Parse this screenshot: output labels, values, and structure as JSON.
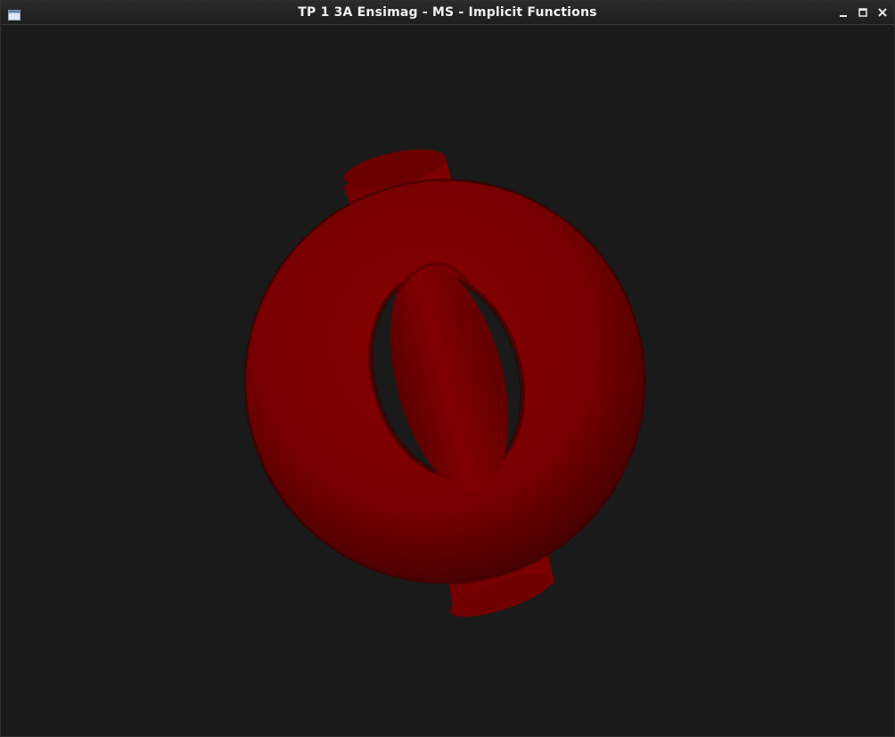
{
  "window": {
    "title": "TP 1 3A Ensimag - MS - Implicit Functions",
    "icon": "window-app-icon",
    "controls": [
      "minimize-icon",
      "maximize-icon",
      "close-icon"
    ]
  },
  "viewport": {
    "background_color": "#1a1a1a",
    "object_color": "#7d0000",
    "object_highlight": "#8c0000",
    "object_shadow": "#3a0000"
  }
}
